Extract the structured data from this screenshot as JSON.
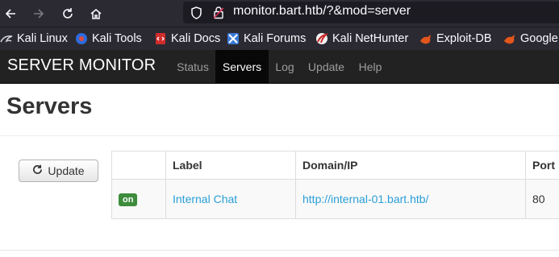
{
  "browser": {
    "url": "monitor.bart.htb/?&mod=server",
    "bookmarks": [
      {
        "label": "Kali Linux",
        "icon": "kali-dragon-icon",
        "color": "#111111"
      },
      {
        "label": "Kali Tools",
        "icon": "kali-tools-icon",
        "color": "#2d6cdf"
      },
      {
        "label": "Kali Docs",
        "icon": "kali-docs-icon",
        "color": "#d12c2c"
      },
      {
        "label": "Kali Forums",
        "icon": "kali-forums-icon",
        "color": "#3a79d8"
      },
      {
        "label": "Kali NetHunter",
        "icon": "nethunter-icon",
        "color": "#c92a2a"
      },
      {
        "label": "Exploit-DB",
        "icon": "exploit-db-icon",
        "color": "#e2561b"
      },
      {
        "label": "Google",
        "icon": "google-hacking-icon",
        "color": "#e2561b"
      }
    ]
  },
  "app": {
    "brand": "SERVER MONITOR",
    "nav": [
      {
        "label": "Status",
        "active": false
      },
      {
        "label": "Servers",
        "active": true
      },
      {
        "label": "Log",
        "active": false
      },
      {
        "label": "Update",
        "active": false
      },
      {
        "label": "Help",
        "active": false
      }
    ]
  },
  "page": {
    "title": "Servers",
    "update_button": "Update"
  },
  "table": {
    "columns": [
      "",
      "Label",
      "Domain/IP",
      "Port"
    ],
    "rows": [
      {
        "status": "on",
        "label": "Internal Chat",
        "domain": "http://internal-01.bart.htb/",
        "port": "80"
      }
    ]
  },
  "colors": {
    "navbar_bg": "#222222",
    "link": "#2a9fd6",
    "status_on": "#3c8c3c"
  }
}
